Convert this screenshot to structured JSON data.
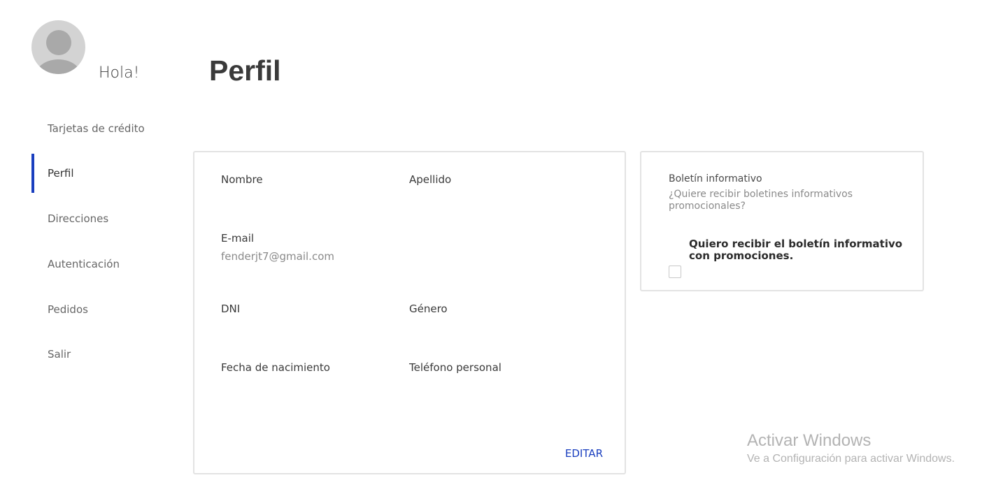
{
  "header": {
    "greeting": "Hola!",
    "page_title": "Perfil"
  },
  "sidebar": {
    "items": [
      {
        "label": "Tarjetas de crédito",
        "active": false
      },
      {
        "label": "Perfil",
        "active": true
      },
      {
        "label": "Direcciones",
        "active": false
      },
      {
        "label": "Autenticación",
        "active": false
      },
      {
        "label": "Pedidos",
        "active": false
      },
      {
        "label": "Salir",
        "active": false
      }
    ],
    "accent_color": "#1a3fbf"
  },
  "profile": {
    "nombre_label": "Nombre",
    "apellido_label": "Apellido",
    "email_label": "E-mail",
    "email_value": "fenderjt7@gmail.com",
    "dni_label": "DNI",
    "genero_label": "Género",
    "fecha_label": "Fecha de nacimiento",
    "telefono_label": "Teléfono personal",
    "edit_label": "EDITAR"
  },
  "newsletter": {
    "title": "Boletín informativo",
    "description": "¿Quiere recibir boletines informativos promocionales?",
    "option_label": "Quiero recibir el boletín informativo con promociones.",
    "checked": false
  },
  "watermark": {
    "title": "Activar Windows",
    "subtitle": "Ve a Configuración para activar Windows."
  }
}
